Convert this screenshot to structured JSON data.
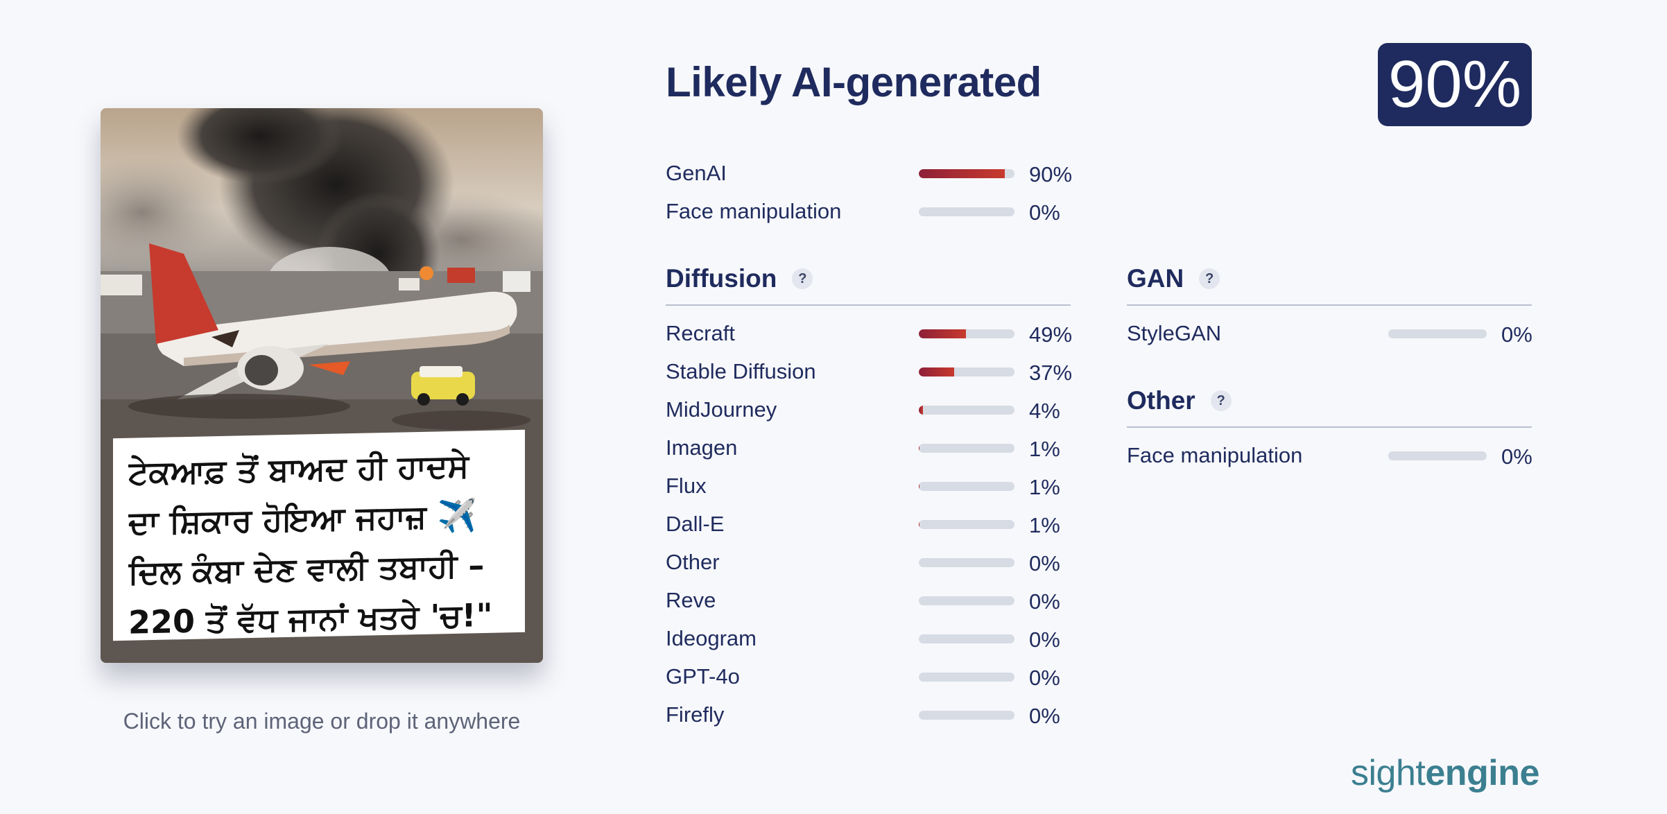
{
  "image": {
    "caption_lines": [
      "ਟੇਕਆਫ਼ ਤੋਂ ਬਾਅਦ ਹੀ ਹਾਦਸੇ",
      "ਦਾ ਸ਼ਿਕਾਰ ਹੋਇਆ ਜਹਾਜ਼ ✈️",
      "ਦਿਲ ਕੰਬਾ ਦੇਣ ਵਾਲੀ ਤਬਾਹੀ –",
      "220 ਤੋਂ ਵੱਧ ਜਾਨਾਂ ਖਤਰੇ 'ਚ!\""
    ],
    "drop_hint": "Click to try an image or drop it anywhere"
  },
  "verdict": {
    "title": "Likely AI-generated",
    "score": "90%"
  },
  "summary": [
    {
      "label": "GenAI",
      "value": 90,
      "pct": "90%"
    },
    {
      "label": "Face manipulation",
      "value": 0,
      "pct": "0%"
    }
  ],
  "diffusion": {
    "title": "Diffusion",
    "help": "?",
    "rows": [
      {
        "label": "Recraft",
        "value": 49,
        "pct": "49%"
      },
      {
        "label": "Stable Diffusion",
        "value": 37,
        "pct": "37%"
      },
      {
        "label": "MidJourney",
        "value": 4,
        "pct": "4%"
      },
      {
        "label": "Imagen",
        "value": 1,
        "pct": "1%"
      },
      {
        "label": "Flux",
        "value": 1,
        "pct": "1%"
      },
      {
        "label": "Dall-E",
        "value": 1,
        "pct": "1%"
      },
      {
        "label": "Other",
        "value": 0,
        "pct": "0%"
      },
      {
        "label": "Reve",
        "value": 0,
        "pct": "0%"
      },
      {
        "label": "Ideogram",
        "value": 0,
        "pct": "0%"
      },
      {
        "label": "GPT-4o",
        "value": 0,
        "pct": "0%"
      },
      {
        "label": "Firefly",
        "value": 0,
        "pct": "0%"
      }
    ]
  },
  "gan": {
    "title": "GAN",
    "help": "?",
    "rows": [
      {
        "label": "StyleGAN",
        "value": 0,
        "pct": "0%"
      }
    ]
  },
  "other": {
    "title": "Other",
    "help": "?",
    "rows": [
      {
        "label": "Face manipulation",
        "value": 0,
        "pct": "0%"
      }
    ]
  },
  "logo": {
    "light": "sight",
    "bold": "engine"
  },
  "colors": {
    "accent": "#1f2b5e",
    "bar_start": "#8e2038",
    "bar_end": "#c73a2e",
    "track": "#d6dbe4"
  }
}
